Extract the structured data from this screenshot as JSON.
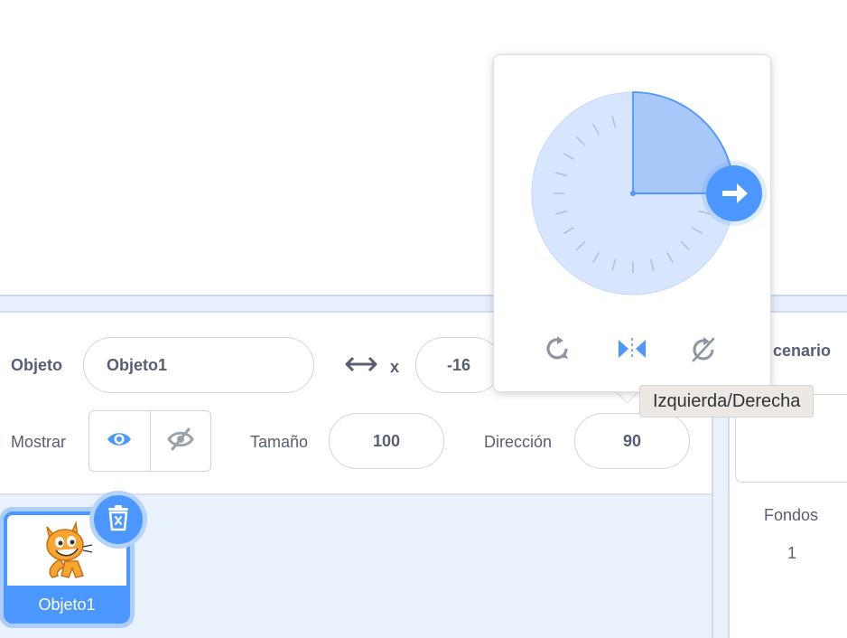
{
  "sprite_info": {
    "sprite_label": "Objeto",
    "sprite_name_value": "Objeto1",
    "x_label": "x",
    "x_value": "-16",
    "show_label": "Mostrar",
    "size_label": "Tamaño",
    "size_value": "100",
    "direction_label": "Dirección",
    "direction_value": "90"
  },
  "direction_popover": {
    "direction_degrees": 90,
    "rotation_styles": [
      "all-around-icon",
      "left-right-icon",
      "dont-rotate-icon"
    ],
    "selected_style": "left-right-icon",
    "tooltip": "Izquierda/Derecha"
  },
  "sprites": [
    {
      "name": "Objeto1",
      "selected": true
    }
  ],
  "stage_panel": {
    "title_partial": "cenario",
    "backdrops_label": "Fondos",
    "backdrops_count": "1"
  },
  "colors": {
    "accent": "#4c97ff",
    "dial_fill": "#d7e5ff",
    "text": "#575e75"
  }
}
